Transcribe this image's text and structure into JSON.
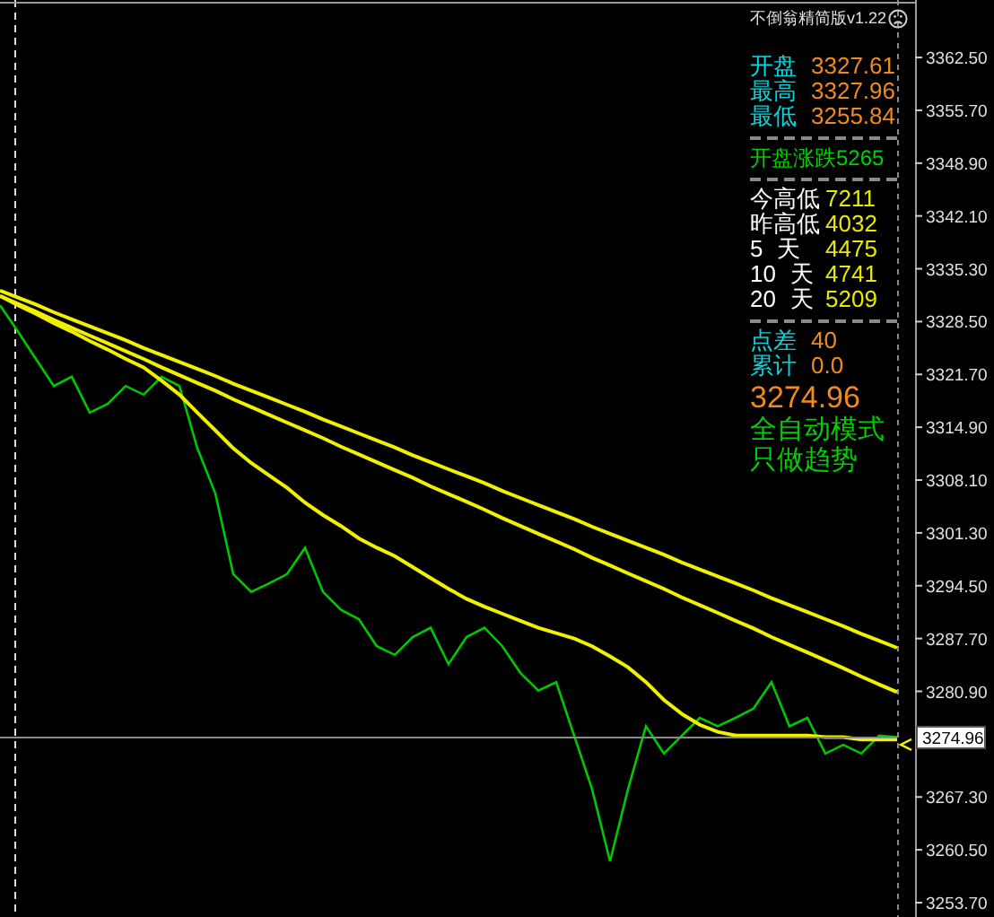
{
  "chart": {
    "current_price_label": "3274.96",
    "chart_data": {
      "type": "line",
      "ylim": [
        3251.85,
        3369.9
      ],
      "yticks": [
        {
          "value": 3362.5,
          "label": "3362.50"
        },
        {
          "value": 3355.7,
          "label": "3355.70"
        },
        {
          "value": 3348.9,
          "label": "3348.90"
        },
        {
          "value": 3342.1,
          "label": "3342.10"
        },
        {
          "value": 3335.3,
          "label": "3335.30"
        },
        {
          "value": 3328.5,
          "label": "3328.50"
        },
        {
          "value": 3321.7,
          "label": "3321.70"
        },
        {
          "value": 3314.9,
          "label": "3314.90"
        },
        {
          "value": 3308.1,
          "label": "3308.10"
        },
        {
          "value": 3301.3,
          "label": "3301.30"
        },
        {
          "value": 3294.5,
          "label": "3294.50"
        },
        {
          "value": 3287.7,
          "label": "3287.70"
        },
        {
          "value": 3280.9,
          "label": "3280.90"
        },
        {
          "value": 3267.3,
          "label": "3267.30"
        },
        {
          "value": 3260.5,
          "label": "3260.50"
        },
        {
          "value": 3253.7,
          "label": "3253.70"
        }
      ],
      "series": [
        {
          "color": "#00c800",
          "values": [
            3330.6,
            3327.2,
            3323.7,
            3320.2,
            3321.4,
            3316.8,
            3317.9,
            3320.2,
            3319.1,
            3321.4,
            3320.2,
            3312.2,
            3306.4,
            3296.0,
            3293.7,
            3294.8,
            3296.0,
            3299.4,
            3293.7,
            3291.4,
            3290.2,
            3286.7,
            3285.6,
            3287.9,
            3289.1,
            3284.4,
            3287.9,
            3289.1,
            3286.7,
            3283.3,
            3281.0,
            3282.1,
            3275.2,
            3268.3,
            3259.0,
            3268.3,
            3276.4,
            3272.9,
            3275.2,
            3277.5,
            3276.4,
            3277.5,
            3278.7,
            3282.1,
            3276.4,
            3277.5,
            3272.9,
            3274.0,
            3272.9,
            3275.2,
            3275.0
          ]
        },
        {
          "color": "#f0f000",
          "values": [
            3331.8,
            3330.6,
            3329.5,
            3328.3,
            3327.2,
            3326.0,
            3324.9,
            3323.7,
            3322.6,
            3320.9,
            3319.1,
            3316.8,
            3314.5,
            3312.2,
            3310.3,
            3308.7,
            3307.1,
            3305.2,
            3303.6,
            3302.2,
            3300.6,
            3299.4,
            3298.3,
            3296.9,
            3295.5,
            3294.1,
            3292.8,
            3291.8,
            3290.9,
            3290.0,
            3289.1,
            3288.4,
            3287.7,
            3286.7,
            3285.4,
            3284.0,
            3282.1,
            3279.8,
            3278.0,
            3276.6,
            3275.7,
            3275.2,
            3275.2,
            3275.2,
            3275.2,
            3275.2,
            3275.0,
            3275.0,
            3274.7,
            3274.7,
            3274.7
          ]
        },
        {
          "color": "#f0f000",
          "values": [
            3331.8,
            3330.8,
            3329.8,
            3328.7,
            3327.7,
            3326.7,
            3325.7,
            3324.7,
            3323.7,
            3322.6,
            3321.6,
            3320.6,
            3319.6,
            3318.5,
            3317.5,
            3316.5,
            3315.5,
            3314.5,
            3313.5,
            3312.4,
            3311.4,
            3310.4,
            3309.4,
            3308.4,
            3307.3,
            3306.3,
            3305.3,
            3304.3,
            3303.2,
            3302.2,
            3301.2,
            3300.2,
            3299.2,
            3298.1,
            3297.1,
            3296.1,
            3295.1,
            3294.1,
            3293.0,
            3292.0,
            3291.0,
            3290.0,
            3289.0,
            3287.9,
            3286.9,
            3285.9,
            3284.9,
            3283.9,
            3282.8,
            3281.8,
            3280.8
          ]
        },
        {
          "color": "#8a8a8a",
          "values": [
            3274.96,
            3274.96,
            3274.96,
            3274.96,
            3274.96,
            3274.96,
            3274.96,
            3274.96,
            3274.96,
            3274.96,
            3274.96,
            3274.96,
            3274.96,
            3274.96,
            3274.96,
            3274.96,
            3274.96,
            3274.96,
            3274.96,
            3274.96,
            3274.96,
            3274.96,
            3274.96,
            3274.96,
            3274.96,
            3274.96,
            3274.96,
            3274.96,
            3274.96,
            3274.96,
            3274.96,
            3274.96,
            3274.96,
            3274.96,
            3274.96,
            3274.96,
            3274.96,
            3274.96,
            3274.96,
            3274.96,
            3274.96,
            3274.96,
            3274.96,
            3274.96,
            3274.96,
            3274.96,
            3274.96,
            3274.96,
            3274.96,
            3274.96,
            3274.96
          ]
        },
        {
          "color": "#f0f000",
          "values": [
            3332.5,
            3331.6,
            3330.7,
            3329.7,
            3328.8,
            3327.9,
            3327.0,
            3326.1,
            3325.1,
            3324.2,
            3323.3,
            3322.4,
            3321.5,
            3320.5,
            3319.6,
            3318.7,
            3317.8,
            3316.9,
            3315.9,
            3315.0,
            3314.1,
            3313.2,
            3312.3,
            3311.3,
            3310.4,
            3309.5,
            3308.6,
            3307.7,
            3306.7,
            3305.8,
            3304.9,
            3304.0,
            3303.1,
            3302.1,
            3301.2,
            3300.3,
            3299.4,
            3298.5,
            3297.5,
            3296.6,
            3295.7,
            3294.8,
            3293.9,
            3292.9,
            3292.0,
            3291.1,
            3290.2,
            3289.3,
            3288.3,
            3287.4,
            3286.5
          ]
        }
      ]
    }
  },
  "indicator_panel": {
    "title": "不倒翁精简版v1.22",
    "sections": [
      {
        "kind": "quotes",
        "rows": [
          {
            "label": "开盘",
            "value": "3327.61"
          },
          {
            "label": "最高",
            "value": "3327.96"
          },
          {
            "label": "最低",
            "value": "3255.84"
          }
        ]
      },
      {
        "kind": "banner",
        "text": "开盘涨跌5265"
      },
      {
        "kind": "ranges",
        "rows": [
          {
            "label": "今高低",
            "value": "7211"
          },
          {
            "label": "昨高低",
            "value": "4032"
          },
          {
            "label": "5",
            "unit": "天",
            "value": "4475"
          },
          {
            "label": "10",
            "unit": "天",
            "value": "4741"
          },
          {
            "label": "20",
            "unit": "天",
            "value": "5209"
          }
        ]
      },
      {
        "kind": "quotes",
        "rows": [
          {
            "label": "点差",
            "value": "40"
          },
          {
            "label": "累计",
            "value": "0.0"
          }
        ]
      },
      {
        "kind": "price",
        "text": "3274.96"
      },
      {
        "kind": "status",
        "lines": [
          "全自动模式",
          "只做趋势"
        ]
      }
    ]
  }
}
